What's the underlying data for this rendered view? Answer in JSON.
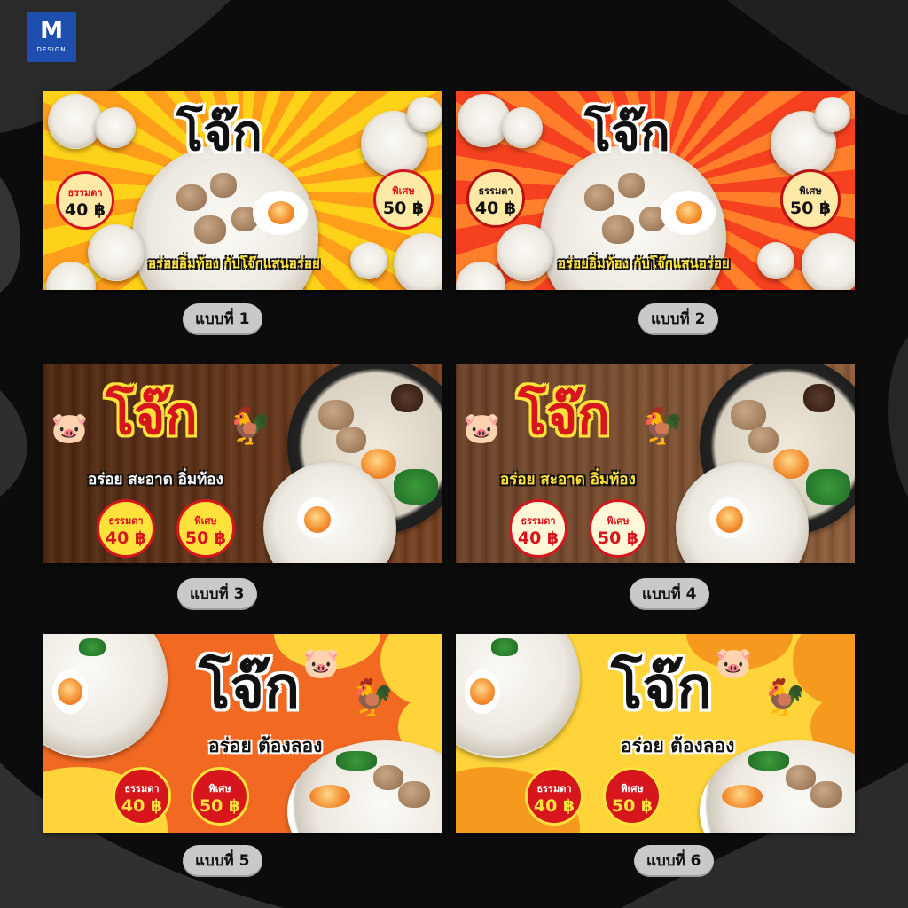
{
  "brand": {
    "logo_mark": "M",
    "logo_text": "DESIGN",
    "accent": "#1f4fae"
  },
  "banners": [
    {
      "title": "โจ๊ก",
      "tagline": "อร่อยอิ่มท้อง กับโจ๊กแสนอร่อย",
      "price_regular_label": "ธรรมดา",
      "price_regular": "40 ฿",
      "price_special_label": "พิเศษ",
      "price_special": "50 ฿",
      "caption": "แบบที่ 1",
      "colors": [
        "#ffd21a",
        "#ff9a1a"
      ]
    },
    {
      "title": "โจ๊ก",
      "tagline": "อร่อยอิ่มท้อง กับโจ๊กแสนอร่อย",
      "price_regular_label": "ธรรมดา",
      "price_regular": "40 ฿",
      "price_special_label": "พิเศษ",
      "price_special": "50 ฿",
      "caption": "แบบที่ 2",
      "colors": [
        "#f5411f",
        "#ff7a2a"
      ]
    },
    {
      "title": "โจ๊ก",
      "tagline": "อร่อย สะอาด อิ่มท้อง",
      "price_regular_label": "ธรรมดา",
      "price_regular": "40 ฿",
      "price_special_label": "พิเศษ",
      "price_special": "50 ฿",
      "caption": "แบบที่ 3",
      "colors": [
        "#5a2f16",
        "#7a4322"
      ],
      "icons": [
        "pig-icon",
        "rooster-icon"
      ]
    },
    {
      "title": "โจ๊ก",
      "tagline": "อร่อย สะอาด อิ่มท้อง",
      "price_regular_label": "ธรรมดา",
      "price_regular": "40 ฿",
      "price_special_label": "พิเศษ",
      "price_special": "50 ฿",
      "caption": "แบบที่ 4",
      "colors": [
        "#6b4127",
        "#8a5a37"
      ],
      "icons": [
        "pig-icon",
        "rooster-icon"
      ]
    },
    {
      "title": "โจ๊ก",
      "tagline": "อร่อย ต้องลอง",
      "price_regular_label": "ธรรมดา",
      "price_regular": "40 ฿",
      "price_special_label": "พิเศษ",
      "price_special": "50 ฿",
      "caption": "แบบที่ 5",
      "colors": [
        "#f26a22",
        "#ffd43a"
      ],
      "icons": [
        "pig-icon",
        "rooster-icon"
      ]
    },
    {
      "title": "โจ๊ก",
      "tagline": "อร่อย ต้องลอง",
      "price_regular_label": "ธรรมดา",
      "price_regular": "40 ฿",
      "price_special_label": "พิเศษ",
      "price_special": "50 ฿",
      "caption": "แบบที่ 6",
      "colors": [
        "#ffd43a",
        "#f59a1e"
      ],
      "icons": [
        "pig-icon",
        "rooster-icon"
      ]
    }
  ]
}
